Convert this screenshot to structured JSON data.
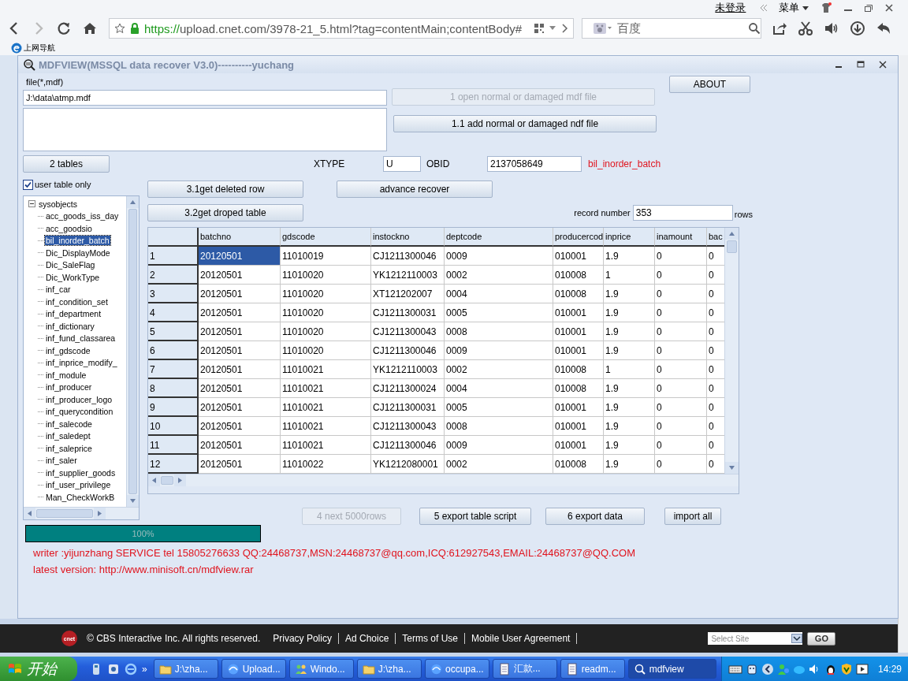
{
  "browser": {
    "login_link": "未登录",
    "menu": "菜单",
    "address": {
      "scheme": "https://",
      "rest": "upload.cnet.com/3978-21_5.html?tag=contentMain;contentBody#"
    },
    "search": {
      "placeholder": "百度"
    },
    "bookmarks": [
      "上网导航"
    ]
  },
  "app": {
    "title": "MDFVIEW(MSSQL data recover V3.0)----------yuchang",
    "file_label": "file(*,mdf)",
    "file_path": "J:\\data\\atmp.mdf",
    "open_button": {
      "label": "1 open normal or damaged mdf file",
      "disabled": true
    },
    "add_button": {
      "label": "1.1 add normal or damaged ndf file",
      "disabled": false
    },
    "about_button": {
      "label": "ABOUT",
      "disabled": false
    },
    "tables_button": {
      "label": "2 tables",
      "disabled": false
    },
    "xtype": {
      "label": "XTYPE",
      "value": "U"
    },
    "obid": {
      "label": "OBID",
      "value": "2137058649"
    },
    "table_name": "bil_inorder_batch",
    "user_table_only": {
      "label": "user table only",
      "checked": true
    },
    "deleted_button": {
      "label": "3.1get deleted row",
      "disabled": false
    },
    "advance_button": {
      "label": "advance recover",
      "disabled": false
    },
    "dropped_button": {
      "label": "3.2get droped table",
      "disabled": false
    },
    "record_number": {
      "label": "record number",
      "value": "353",
      "unit": "rows"
    },
    "tree": {
      "label": "sysobjects",
      "expanded": true,
      "children": [
        {
          "label": "acc_goods_iss_day",
          "selected": false
        },
        {
          "label": "acc_goodsio",
          "selected": false
        },
        {
          "label": "bil_inorder_batch",
          "selected": true
        },
        {
          "label": "Dic_DisplayMode",
          "selected": false
        },
        {
          "label": "Dic_SaleFlag",
          "selected": false
        },
        {
          "label": "Dic_WorkType",
          "selected": false
        },
        {
          "label": "inf_car",
          "selected": false
        },
        {
          "label": "inf_condition_set",
          "selected": false
        },
        {
          "label": "inf_department",
          "selected": false
        },
        {
          "label": "inf_dictionary",
          "selected": false
        },
        {
          "label": "inf_fund_classarea",
          "selected": false
        },
        {
          "label": "inf_gdscode",
          "selected": false
        },
        {
          "label": "inf_inprice_modify_",
          "selected": false
        },
        {
          "label": "inf_module",
          "selected": false
        },
        {
          "label": "inf_producer",
          "selected": false
        },
        {
          "label": "inf_producer_logo",
          "selected": false
        },
        {
          "label": "inf_querycondition",
          "selected": false
        },
        {
          "label": "inf_salecode",
          "selected": false
        },
        {
          "label": "inf_saledept",
          "selected": false
        },
        {
          "label": "inf_saleprice",
          "selected": false
        },
        {
          "label": "inf_saler",
          "selected": false
        },
        {
          "label": "inf_supplier_goods",
          "selected": false
        },
        {
          "label": "inf_user_privilege",
          "selected": false
        },
        {
          "label": "Man_CheckWorkB",
          "selected": false
        }
      ]
    },
    "grid": {
      "columns": [
        "batchno",
        "gdscode",
        "instockno",
        "deptcode",
        "producercod",
        "inprice",
        "inamount",
        "bac"
      ],
      "rows": [
        {
          "number": "1",
          "selected": true,
          "cells": [
            "20120501",
            "11010019",
            "CJ1211300046",
            "0009",
            "010001",
            "1.9",
            "0",
            "0"
          ]
        },
        {
          "number": "2",
          "selected": false,
          "cells": [
            "20120501",
            "11010020",
            "YK1212110003",
            "0002",
            "010008",
            "1",
            "0",
            "0"
          ]
        },
        {
          "number": "3",
          "selected": false,
          "cells": [
            "20120501",
            "11010020",
            "XT121202007",
            "0004",
            "010008",
            "1.9",
            "0",
            "0"
          ]
        },
        {
          "number": "4",
          "selected": false,
          "cells": [
            "20120501",
            "11010020",
            "CJ1211300031",
            "0005",
            "010001",
            "1.9",
            "0",
            "0"
          ]
        },
        {
          "number": "5",
          "selected": false,
          "cells": [
            "20120501",
            "11010020",
            "CJ1211300043",
            "0008",
            "010001",
            "1.9",
            "0",
            "0"
          ]
        },
        {
          "number": "6",
          "selected": false,
          "cells": [
            "20120501",
            "11010020",
            "CJ1211300046",
            "0009",
            "010001",
            "1.9",
            "0",
            "0"
          ]
        },
        {
          "number": "7",
          "selected": false,
          "cells": [
            "20120501",
            "11010021",
            "YK1212110003",
            "0002",
            "010008",
            "1",
            "0",
            "0"
          ]
        },
        {
          "number": "8",
          "selected": false,
          "cells": [
            "20120501",
            "11010021",
            "CJ1211300024",
            "0004",
            "010008",
            "1.9",
            "0",
            "0"
          ]
        },
        {
          "number": "9",
          "selected": false,
          "cells": [
            "20120501",
            "11010021",
            "CJ1211300031",
            "0005",
            "010001",
            "1.9",
            "0",
            "0"
          ]
        },
        {
          "number": "10",
          "selected": false,
          "cells": [
            "20120501",
            "11010021",
            "CJ1211300043",
            "0008",
            "010001",
            "1.9",
            "0",
            "0"
          ]
        },
        {
          "number": "11",
          "selected": false,
          "cells": [
            "20120501",
            "11010021",
            "CJ1211300046",
            "0009",
            "010001",
            "1.9",
            "0",
            "0"
          ]
        },
        {
          "number": "12",
          "selected": false,
          "cells": [
            "20120501",
            "11010022",
            "YK1212080001",
            "0002",
            "010008",
            "1.9",
            "0",
            "0"
          ]
        }
      ]
    },
    "bottom_buttons": [
      {
        "label": "4 next 5000rows",
        "disabled": true
      },
      {
        "label": "5 export table script",
        "disabled": false
      },
      {
        "label": "6 export data",
        "disabled": false
      },
      {
        "label": "import all",
        "disabled": false
      }
    ],
    "progress": {
      "level": 1,
      "text": "100%"
    },
    "contact": "writer :yijunzhang SERVICE tel 15805276633 QQ:24468737,MSN:24468737@qq.com,ICQ:612927543,EMAIL:24468737@QQ.COM",
    "latest_version": "latest version: http://www.minisoft.cn/mdfview.rar"
  },
  "footer": {
    "logo": "cnet",
    "copyright": "© CBS Interactive Inc. All rights reserved.",
    "links": [
      "Privacy Policy",
      "Ad Choice",
      "Terms of Use",
      "Mobile User Agreement"
    ],
    "site_select": "Select Site",
    "go": "GO"
  },
  "taskbar": {
    "start": "开始",
    "more": "»",
    "items": [
      {
        "label": "J:\\zha...",
        "kind": "folder",
        "selected": false
      },
      {
        "label": "Upload...",
        "kind": "browser",
        "selected": false
      },
      {
        "label": "Windo...",
        "kind": "people",
        "selected": false
      },
      {
        "label": "J:\\zha...",
        "kind": "folder",
        "selected": false
      },
      {
        "label": "occupa...",
        "kind": "browser",
        "selected": false
      },
      {
        "label": "汇款...",
        "kind": "doc",
        "selected": false
      },
      {
        "label": "readm...",
        "kind": "doc",
        "selected": false
      },
      {
        "label": "mdfview",
        "kind": "app",
        "selected": true
      }
    ],
    "clock": "14:29"
  }
}
